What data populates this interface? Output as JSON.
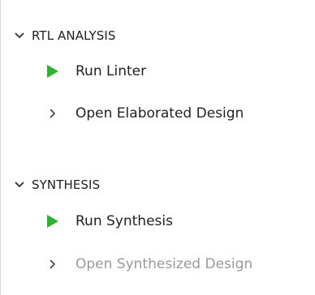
{
  "flow_navigator": {
    "sections": [
      {
        "header": "RTL ANALYSIS",
        "items": [
          {
            "label": "Run Linter",
            "icon": "play-icon",
            "enabled": true
          },
          {
            "label": "Open Elaborated Design",
            "icon": "chevron-right-icon",
            "enabled": true
          }
        ]
      },
      {
        "header": "SYNTHESIS",
        "items": [
          {
            "label": "Run Synthesis",
            "icon": "play-icon",
            "enabled": true
          },
          {
            "label": "Open Synthesized Design",
            "icon": "chevron-right-icon",
            "enabled": false
          }
        ]
      }
    ]
  },
  "colors": {
    "play_green": "#2ab52a",
    "text": "#222222",
    "disabled_text": "#9a9a9a",
    "chevron": "#444444"
  }
}
